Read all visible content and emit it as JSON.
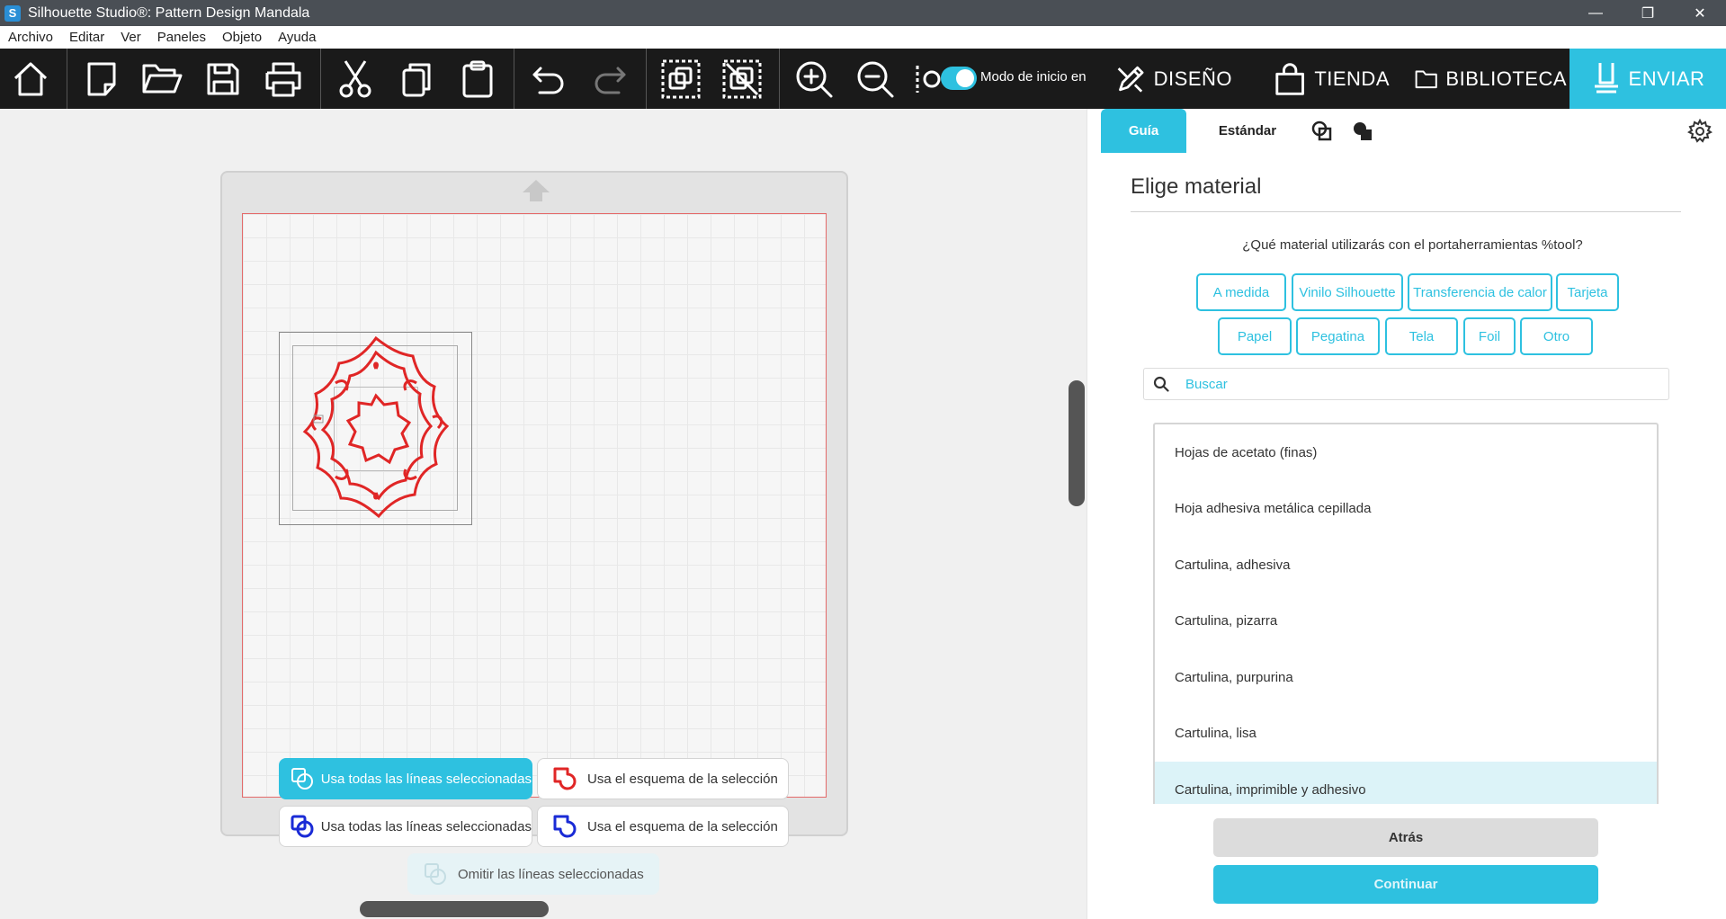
{
  "window": {
    "title": "Silhouette Studio®: Pattern Design Mandala",
    "app_icon_letter": "S",
    "minimize": "—",
    "restore": "❐",
    "close": "✕"
  },
  "menu": [
    "Archivo",
    "Editar",
    "Ver",
    "Paneles",
    "Objeto",
    "Ayuda"
  ],
  "toolbar": {
    "start_mode_label": "Modo de inicio en",
    "start_mode_on": true,
    "tabs": {
      "design": "DISEÑO",
      "store": "TIENDA",
      "library": "BIBLIOTECA",
      "send": "ENVIAR"
    }
  },
  "canvas": {
    "actions": {
      "cut_all_lines": "Usa todas las líneas seleccionadas",
      "cut_outline": "Usa el esquema de la selección",
      "sketch_all_lines": "Usa todas las líneas seleccionadas",
      "sketch_outline": "Usa el esquema de la selección",
      "skip_lines": "Omitir las líneas seleccionadas"
    }
  },
  "panel": {
    "tabs": {
      "guide": "Guía",
      "standard": "Estándar"
    },
    "title": "Elige material",
    "question": "¿Qué material utilizarás con el portaherramientas %tool?",
    "chips": [
      "A medida",
      "Vinilo Silhouette",
      "Transferencia de calor",
      "Tarjeta",
      "Papel",
      "Pegatina",
      "Tela",
      "Foil",
      "Otro"
    ],
    "search_placeholder": "Buscar",
    "materials": [
      "Hojas de acetato (finas)",
      "Hoja adhesiva metálica cepillada",
      "Cartulina, adhesiva",
      "Cartulina, pizarra",
      "Cartulina, purpurina",
      "Cartulina, lisa",
      "Cartulina, imprimible y adhesivo"
    ],
    "selected_material_index": 6,
    "back": "Atrás",
    "continue": "Continuar"
  },
  "colors": {
    "accent": "#2ec1e0",
    "toolbar_bg": "#1a1a1a",
    "cut_line": "#e02626",
    "sketch_line": "#1a2bd6"
  }
}
